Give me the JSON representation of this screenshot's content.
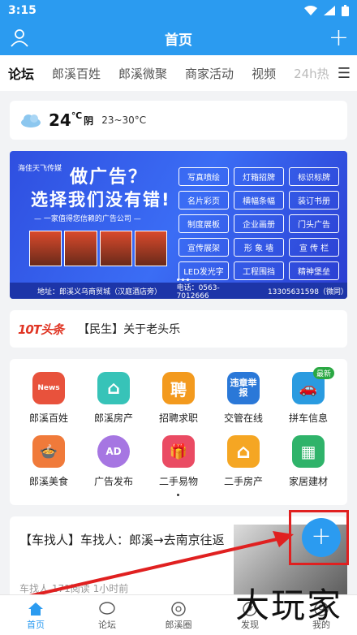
{
  "status_bar": {
    "time": "3:15"
  },
  "header": {
    "title": "首页"
  },
  "tabs": [
    "论坛",
    "郎溪百姓",
    "郎溪微聚",
    "商家活动",
    "视频",
    "24h热"
  ],
  "weather": {
    "temp": "24",
    "unit": "℃",
    "condition": "阴",
    "range": "23~30°C"
  },
  "banner": {
    "logo": "海佳天飞传媒",
    "headline1": "做广告？",
    "headline2": "选择我们没有错!",
    "subline": "— 一家值得您信赖的广告公司 —",
    "services": [
      "写真喷绘",
      "灯箱招牌",
      "标识标牌",
      "名片彩页",
      "横幅条幅",
      "装订书册",
      "制度展板",
      "企业画册",
      "门头广告",
      "宣传展架",
      "形 象 墙",
      "宣 传 栏",
      "LED发光字",
      "工程围挡",
      "精神堡垒"
    ],
    "address": "地址：郎溪义乌商贸城（汉庭酒店旁）",
    "phone": "电话：0563-7012666",
    "mobile": "13305631598（微同）"
  },
  "news": {
    "brand": "10T头条",
    "text": "【民生】关于老头乐"
  },
  "services": [
    {
      "label": "郎溪百姓",
      "icon": "news-icon",
      "color": "#e8523c",
      "glyph": "News"
    },
    {
      "label": "郎溪房产",
      "icon": "house-icon",
      "color": "#37c3b8",
      "glyph": "⌂"
    },
    {
      "label": "招聘求职",
      "icon": "recruit-icon",
      "color": "#f39a1e",
      "glyph": "聘"
    },
    {
      "label": "交管在线",
      "icon": "traffic-icon",
      "color": "#2a78d8",
      "glyph": "违章举报"
    },
    {
      "label": "拼车信息",
      "icon": "carpool-icon",
      "color": "#2a9be0",
      "glyph": "🚗",
      "badge": "最新"
    },
    {
      "label": "郎溪美食",
      "icon": "food-icon",
      "color": "#f07a3a",
      "glyph": "🍲"
    },
    {
      "label": "广告发布",
      "icon": "ad-icon",
      "color": "#a676e2",
      "glyph": "AD"
    },
    {
      "label": "二手易物",
      "icon": "gift-icon",
      "color": "#ea4b63",
      "glyph": "🎁"
    },
    {
      "label": "二手房产",
      "icon": "home-icon",
      "color": "#f5a623",
      "glyph": "⌂"
    },
    {
      "label": "家居建材",
      "icon": "building-icon",
      "color": "#2fb36a",
      "glyph": "▦"
    }
  ],
  "post": {
    "title": "【车找人】车找人：郎溪→去南京往返",
    "author": "车找人",
    "views": "171阅读",
    "time": "1小时前"
  },
  "bottom_nav": [
    "首页",
    "论坛",
    "郎溪圈",
    "发现",
    "我的"
  ],
  "watermark": "大玩家"
}
